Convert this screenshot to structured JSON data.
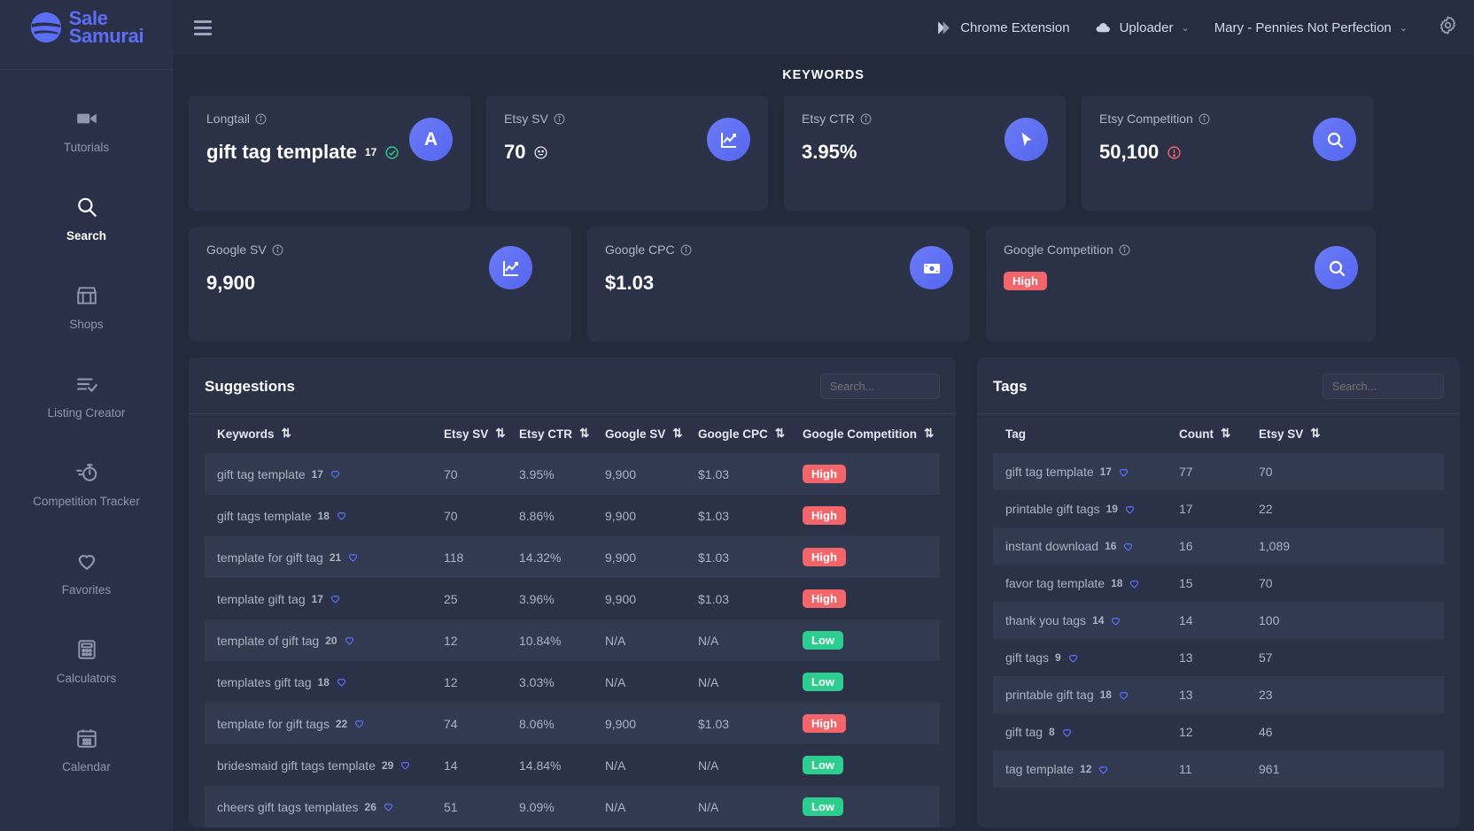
{
  "brand": {
    "line1": "Sale",
    "line2": "Samurai"
  },
  "sidebar": {
    "items": [
      {
        "label": "Tutorials",
        "icon": "video-camera-icon",
        "active": false
      },
      {
        "label": "Search",
        "icon": "search-icon",
        "active": true
      },
      {
        "label": "Shops",
        "icon": "storefront-icon",
        "active": false
      },
      {
        "label": "Listing Creator",
        "icon": "list-check-icon",
        "active": false
      },
      {
        "label": "Competition Tracker",
        "icon": "stopwatch-icon",
        "active": false
      },
      {
        "label": "Favorites",
        "icon": "heart-icon",
        "active": false
      },
      {
        "label": "Calculators",
        "icon": "calculator-icon",
        "active": false
      },
      {
        "label": "Calendar",
        "icon": "calendar-icon",
        "active": false
      }
    ]
  },
  "topbar": {
    "menu_icon": "hamburger-icon",
    "chrome_extension": "Chrome Extension",
    "uploader": "Uploader",
    "account": "Mary - Pennies Not Perfection",
    "settings_icon": "gear-icon",
    "caret": "⌄"
  },
  "page": {
    "title": "KEYWORDS"
  },
  "cards_row1": [
    {
      "label": "Longtail",
      "value": "gift tag template",
      "sup": "17",
      "status": "check",
      "icon": "letter-a-icon"
    },
    {
      "label": "Etsy SV",
      "value": "70",
      "status": "neutral-face",
      "icon": "chart-line-icon"
    },
    {
      "label": "Etsy CTR",
      "value": "3.95%",
      "status": "",
      "icon": "cursor-pointer-icon"
    },
    {
      "label": "Etsy Competition",
      "value": "50,100",
      "status": "alert",
      "icon": "magnifier-icon"
    }
  ],
  "cards_row2": [
    {
      "label": "Google SV",
      "value": "9,900",
      "icon": "chart-line-icon"
    },
    {
      "label": "Google CPC",
      "value": "$1.03",
      "icon": "money-icon"
    },
    {
      "label": "Google Competition",
      "badge": "High",
      "badge_kind": "high",
      "icon": "magnifier-icon"
    }
  ],
  "suggestions": {
    "title": "Suggestions",
    "search_placeholder": "Search...",
    "columns": [
      "Keywords",
      "Etsy SV",
      "Etsy CTR",
      "Google SV",
      "Google CPC",
      "Google Competition"
    ],
    "rows": [
      {
        "keyword": "gift tag template",
        "sup": "17",
        "etsy_sv": "70",
        "etsy_ctr": "3.95%",
        "google_sv": "9,900",
        "google_cpc": "$1.03",
        "comp": "High",
        "comp_kind": "high"
      },
      {
        "keyword": "gift tags template",
        "sup": "18",
        "etsy_sv": "70",
        "etsy_ctr": "8.86%",
        "google_sv": "9,900",
        "google_cpc": "$1.03",
        "comp": "High",
        "comp_kind": "high"
      },
      {
        "keyword": "template for gift tag",
        "sup": "21",
        "etsy_sv": "118",
        "etsy_ctr": "14.32%",
        "google_sv": "9,900",
        "google_cpc": "$1.03",
        "comp": "High",
        "comp_kind": "high"
      },
      {
        "keyword": "template gift tag",
        "sup": "17",
        "etsy_sv": "25",
        "etsy_ctr": "3.96%",
        "google_sv": "9,900",
        "google_cpc": "$1.03",
        "comp": "High",
        "comp_kind": "high"
      },
      {
        "keyword": "template of gift tag",
        "sup": "20",
        "etsy_sv": "12",
        "etsy_ctr": "10.84%",
        "google_sv": "N/A",
        "google_cpc": "N/A",
        "comp": "Low",
        "comp_kind": "low"
      },
      {
        "keyword": "templates gift tag",
        "sup": "18",
        "etsy_sv": "12",
        "etsy_ctr": "3.03%",
        "google_sv": "N/A",
        "google_cpc": "N/A",
        "comp": "Low",
        "comp_kind": "low"
      },
      {
        "keyword": "template for gift tags",
        "sup": "22",
        "etsy_sv": "74",
        "etsy_ctr": "8.06%",
        "google_sv": "9,900",
        "google_cpc": "$1.03",
        "comp": "High",
        "comp_kind": "high"
      },
      {
        "keyword": "bridesmaid gift tags template",
        "sup": "29",
        "etsy_sv": "14",
        "etsy_ctr": "14.84%",
        "google_sv": "N/A",
        "google_cpc": "N/A",
        "comp": "Low",
        "comp_kind": "low"
      },
      {
        "keyword": "cheers gift tags templates",
        "sup": "26",
        "etsy_sv": "51",
        "etsy_ctr": "9.09%",
        "google_sv": "N/A",
        "google_cpc": "N/A",
        "comp": "Low",
        "comp_kind": "low"
      }
    ]
  },
  "tags": {
    "title": "Tags",
    "search_placeholder": "Search...",
    "columns": [
      "Tag",
      "Count",
      "Etsy SV"
    ],
    "rows": [
      {
        "tag": "gift tag template",
        "sup": "17",
        "count": "77",
        "etsy_sv": "70"
      },
      {
        "tag": "printable gift tags",
        "sup": "19",
        "count": "17",
        "etsy_sv": "22"
      },
      {
        "tag": "instant download",
        "sup": "16",
        "count": "16",
        "etsy_sv": "1,089"
      },
      {
        "tag": "favor tag template",
        "sup": "18",
        "count": "15",
        "etsy_sv": "70"
      },
      {
        "tag": "thank you tags",
        "sup": "14",
        "count": "14",
        "etsy_sv": "100"
      },
      {
        "tag": "gift tags",
        "sup": "9",
        "count": "13",
        "etsy_sv": "57"
      },
      {
        "tag": "printable gift tag",
        "sup": "18",
        "count": "13",
        "etsy_sv": "23"
      },
      {
        "tag": "gift tag",
        "sup": "8",
        "count": "12",
        "etsy_sv": "46"
      },
      {
        "tag": "tag template",
        "sup": "12",
        "count": "11",
        "etsy_sv": "961"
      }
    ]
  },
  "colors": {
    "accent": "#5b6ef5",
    "sidebar_bg": "#2a3047",
    "page_bg": "#232a3b",
    "card_bg": "#2b3247",
    "high": "#f2656b",
    "low": "#2dcd8f"
  }
}
